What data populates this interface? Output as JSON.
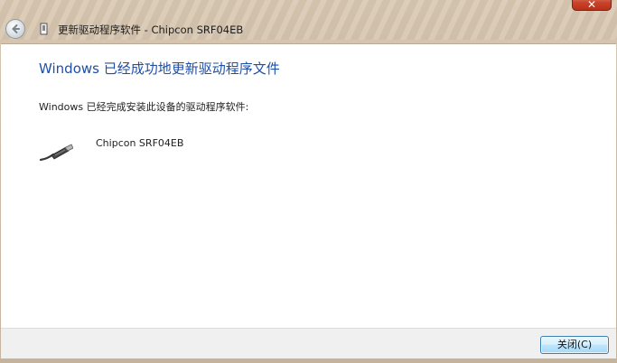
{
  "window": {
    "title": "更新驱动程序软件 - Chipcon SRF04EB",
    "close_glyph": "✕"
  },
  "content": {
    "heading": "Windows 已经成功地更新驱动程序文件",
    "subtext": "Windows 已经完成安装此设备的驱动程序软件:",
    "device_name": "Chipcon SRF04EB",
    "device_icon": "usb-cable-icon"
  },
  "footer": {
    "close_label": "关闭(C)"
  },
  "colors": {
    "heading": "#1f4fa6",
    "close_button": "#c9432a"
  }
}
